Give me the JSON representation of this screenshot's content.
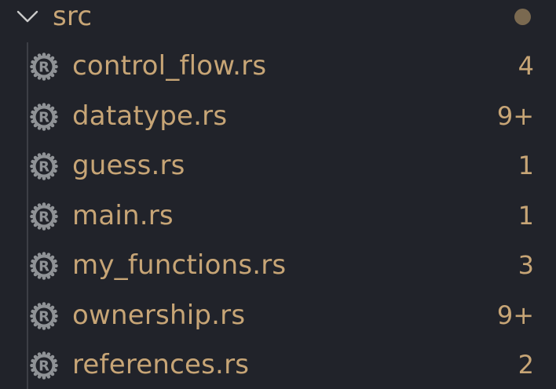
{
  "colors": {
    "background": "#21232a",
    "modified_text": "#c7a576",
    "icon_gray": "#8f9296",
    "modified_dot": "#7a6950",
    "indent_guide": "#3c3e45"
  },
  "folder": {
    "name": "src",
    "expanded": true,
    "chevron_icon": "chevron-down-icon",
    "status_icon": "modified-dot-icon"
  },
  "files": [
    {
      "name": "control_flow.rs",
      "count": "4",
      "icon": "rust-icon"
    },
    {
      "name": "datatype.rs",
      "count": "9+",
      "icon": "rust-icon"
    },
    {
      "name": "guess.rs",
      "count": "1",
      "icon": "rust-icon"
    },
    {
      "name": "main.rs",
      "count": "1",
      "icon": "rust-icon"
    },
    {
      "name": "my_functions.rs",
      "count": "3",
      "icon": "rust-icon"
    },
    {
      "name": "ownership.rs",
      "count": "9+",
      "icon": "rust-icon"
    },
    {
      "name": "references.rs",
      "count": "2",
      "icon": "rust-icon"
    }
  ]
}
